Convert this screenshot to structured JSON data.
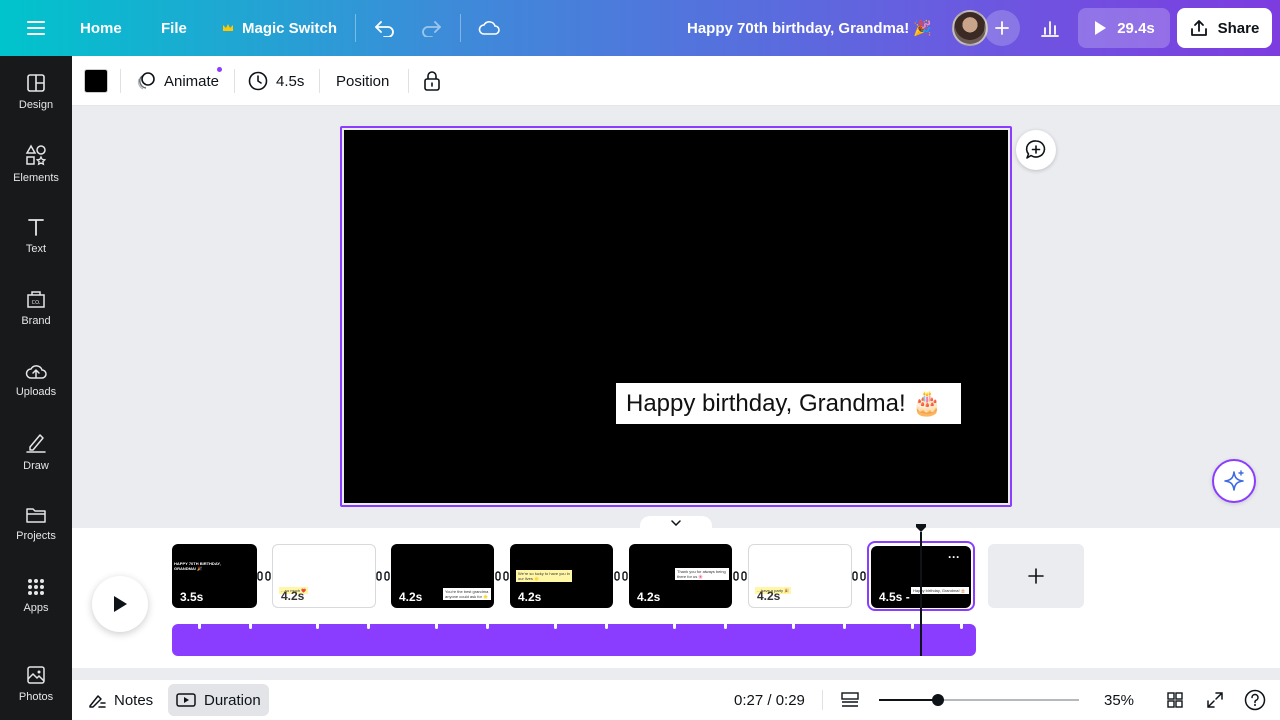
{
  "topbar": {
    "home_label": "Home",
    "file_label": "File",
    "magic_switch_label": "Magic Switch",
    "doc_title": "Happy 70th birthday, Grandma! 🎉",
    "play_duration": "29.4s",
    "share_label": "Share"
  },
  "sidebar": {
    "items": [
      {
        "label": "Design",
        "icon": "design-icon"
      },
      {
        "label": "Elements",
        "icon": "elements-icon"
      },
      {
        "label": "Text",
        "icon": "text-icon"
      },
      {
        "label": "Brand",
        "icon": "brand-icon"
      },
      {
        "label": "Uploads",
        "icon": "uploads-icon"
      },
      {
        "label": "Draw",
        "icon": "draw-icon"
      },
      {
        "label": "Projects",
        "icon": "projects-icon"
      },
      {
        "label": "Apps",
        "icon": "apps-icon"
      },
      {
        "label": "Photos",
        "icon": "photos-icon"
      }
    ]
  },
  "toolbar": {
    "color": "#000000",
    "animate_label": "Animate",
    "duration_label": "4.5s",
    "position_label": "Position"
  },
  "canvas": {
    "caption_text": "Happy birthday, Grandma! 🎂",
    "background": "#000000"
  },
  "timeline": {
    "pages": [
      {
        "duration": "3.5s",
        "theme": "black",
        "preview_text": "HAPPY 70TH BIRTHDAY, GRANDMA! 🎉"
      },
      {
        "duration": "4.2s",
        "theme": "white",
        "preview_text": "…so much ❤️"
      },
      {
        "duration": "4.2s",
        "theme": "black",
        "preview_text": "You're the best grandma anyone could ask for 🌟"
      },
      {
        "duration": "4.2s",
        "theme": "black",
        "preview_text": "We're so lucky to have you in our lives 🌟"
      },
      {
        "duration": "4.2s",
        "theme": "black",
        "preview_text": "Thank you for always being there for us 🌸"
      },
      {
        "duration": "4.2s",
        "theme": "white",
        "preview_text": "…have a party 🎉"
      },
      {
        "duration": "4.5s -",
        "theme": "black",
        "preview_text": "Happy birthday, Grandma! 🎂"
      }
    ],
    "more_label": "···"
  },
  "bottombar": {
    "notes_label": "Notes",
    "duration_label": "Duration",
    "time_readout": "0:27 / 0:29",
    "zoom_level": "35%",
    "zoom_value": 35
  },
  "colors": {
    "accent": "#8b3dff",
    "sidebar_bg": "#18191b",
    "topbar_gradient": [
      "#00c4cc",
      "#7d3ce0"
    ]
  }
}
